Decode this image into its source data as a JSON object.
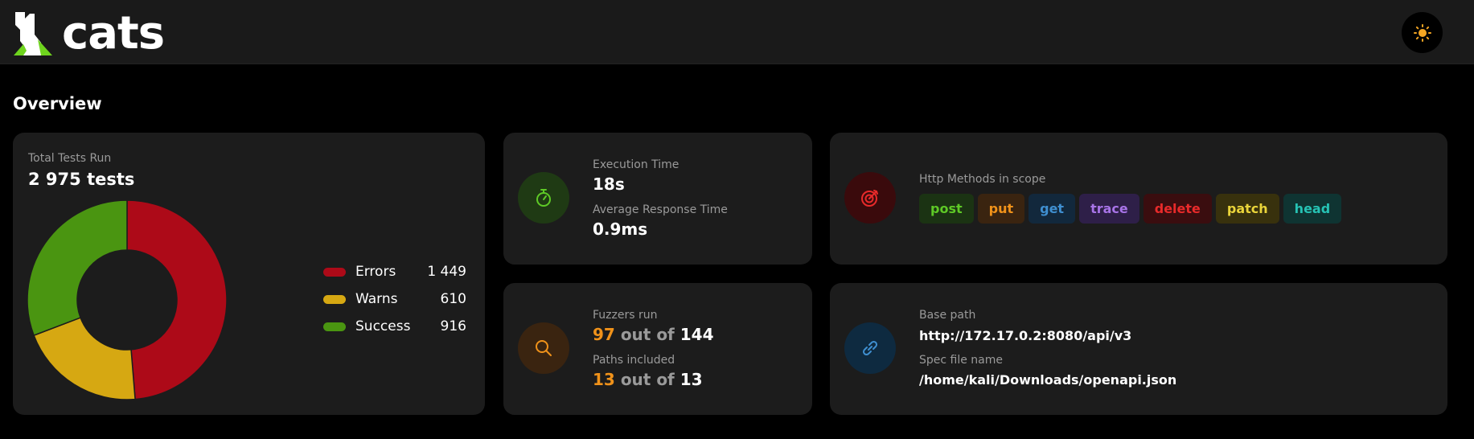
{
  "header": {
    "brand": "cats",
    "theme_toggle_icon": "sun-icon"
  },
  "overview": {
    "title": "Overview"
  },
  "tests": {
    "label": "Total Tests Run",
    "total": "2 975 tests",
    "chart_data": {
      "type": "pie",
      "categories": [
        "Errors",
        "Warns",
        "Success"
      ],
      "values": [
        1449,
        610,
        916
      ],
      "colors": [
        "#ad0a18",
        "#d6a812",
        "#4a9511"
      ]
    },
    "legend": [
      {
        "label": "Errors",
        "value": "1 449",
        "color": "#ad0a18"
      },
      {
        "label": "Warns",
        "value": "610",
        "color": "#d6a812"
      },
      {
        "label": "Success",
        "value": "916",
        "color": "#4a9511"
      }
    ]
  },
  "execution": {
    "icon": "stopwatch-icon",
    "time_label": "Execution Time",
    "time_value": "18s",
    "avg_label": "Average Response Time",
    "avg_value": "0.9ms"
  },
  "fuzzers": {
    "icon": "search-icon",
    "run_label": "Fuzzers run",
    "run_count": "97",
    "run_of": "out of",
    "run_total": "144",
    "paths_label": "Paths included",
    "paths_count": "13",
    "paths_of": "out of",
    "paths_total": "13"
  },
  "http": {
    "icon": "target-icon",
    "label": "Http Methods in scope",
    "methods": [
      {
        "name": "post",
        "color": "#5ec926",
        "bg": "#1b3313"
      },
      {
        "name": "put",
        "color": "#f0921a",
        "bg": "#3a2410"
      },
      {
        "name": "get",
        "color": "#3f8fd0",
        "bg": "#12283c"
      },
      {
        "name": "trace",
        "color": "#a874e8",
        "bg": "#2e1f48"
      },
      {
        "name": "delete",
        "color": "#e82a2a",
        "bg": "#3a0d0f"
      },
      {
        "name": "patch",
        "color": "#ead43a",
        "bg": "#38310d"
      },
      {
        "name": "head",
        "color": "#26c2b4",
        "bg": "#0f3432"
      }
    ]
  },
  "paths": {
    "icon": "link-icon",
    "base_label": "Base path",
    "base_value": "http://172.17.0.2:8080/api/v3",
    "spec_label": "Spec file name",
    "spec_value": "/home/kali/Downloads/openapi.json"
  }
}
